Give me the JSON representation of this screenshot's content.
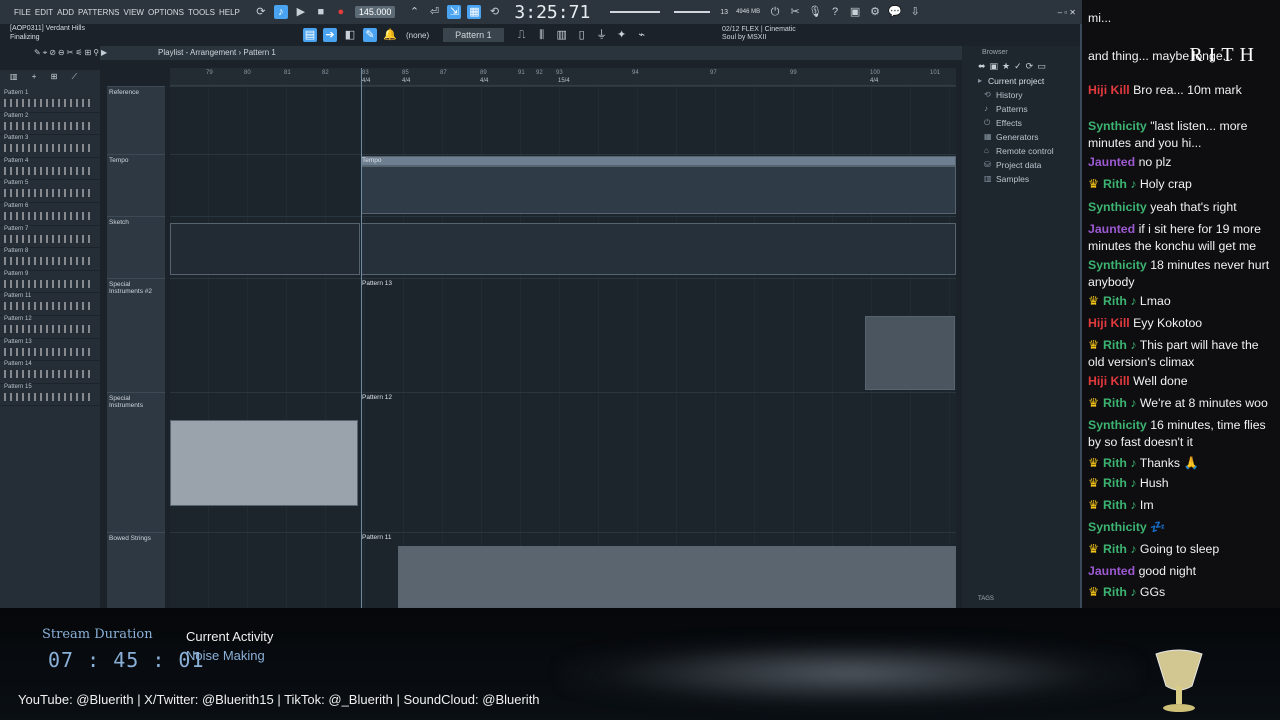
{
  "app": {
    "menu": [
      "FILE",
      "EDIT",
      "ADD",
      "PATTERNS",
      "VIEW",
      "OPTIONS",
      "TOOLS",
      "HELP"
    ],
    "tempo": "145.000",
    "clock": "3:25:71",
    "clock_suffix": "",
    "memory": "4946 MB",
    "cpu_small": "13",
    "song_line1": "[AOP0311] Verdant Hills",
    "song_line2": "Finalizing",
    "pattern_selector": "Pattern 1",
    "snap": "(none)",
    "flex_line1": "02/12  FLEX | Cinematic",
    "flex_line2": "Soul by MSXII"
  },
  "playlist": {
    "title": "Playlist - Arrangement",
    "pattern": "Pattern 1",
    "ruler_ticks": [
      "79",
      "80",
      "81",
      "82",
      "83",
      "85",
      "87",
      "89",
      "91",
      "92",
      "93",
      "94",
      "97",
      "99",
      "100",
      "101"
    ],
    "time_sigs": [
      "4/4",
      "4/4",
      "4/4",
      "15/4",
      "4/4"
    ],
    "tracks": [
      {
        "name": "Reference"
      },
      {
        "name": "Tempo"
      },
      {
        "name": "Sketch"
      },
      {
        "name": "Special Instruments #2"
      },
      {
        "name": "Special Instruments"
      },
      {
        "name": "Bowed Strings"
      }
    ],
    "clips": [
      "Tempo",
      "Pattern 13",
      "Pattern 12",
      "Pattern 11"
    ]
  },
  "patterns": [
    "Pattern 1",
    "Pattern 2",
    "Pattern 3",
    "Pattern 4",
    "Pattern 5",
    "Pattern 6",
    "Pattern 7",
    "Pattern 8",
    "Pattern 9",
    "Pattern 11",
    "Pattern 12",
    "Pattern 13",
    "Pattern 14",
    "Pattern 15"
  ],
  "browser": {
    "title": "Browser",
    "items": [
      {
        "label": "Current project",
        "icon": "folder-icon"
      },
      {
        "label": "History",
        "icon": "history-icon"
      },
      {
        "label": "Patterns",
        "icon": "note-icon"
      },
      {
        "label": "Effects",
        "icon": "plug-icon"
      },
      {
        "label": "Generators",
        "icon": "generator-icon"
      },
      {
        "label": "Remote control",
        "icon": "remote-icon"
      },
      {
        "label": "Project data",
        "icon": "data-icon"
      },
      {
        "label": "Samples",
        "icon": "sample-icon"
      }
    ],
    "tags": "TAGS"
  },
  "chat": {
    "brand": "RITH",
    "messages": [
      {
        "user": "",
        "text": "mi...",
        "color": "#f2f2f2",
        "crown": false
      },
      {
        "user": "",
        "text": "and thing... maybe longe...",
        "color": "#f2f2f2",
        "crown": false
      },
      {
        "user": "Hiji Kill",
        "text": "Bro rea... 10m mark",
        "color": "#e0393e",
        "crown": false
      },
      {
        "user": "Synthicity",
        "text": "\"last listen... more minutes and you hi...",
        "color": "#3cb371",
        "crown": false
      },
      {
        "user": "Jaunted",
        "text": "no plz",
        "color": "#9b59d0",
        "crown": false
      },
      {
        "user": "Rith ♪",
        "text": "Holy crap",
        "color": "#3cb371",
        "crown": true
      },
      {
        "user": "Synthicity",
        "text": "yeah that's right",
        "color": "#3cb371",
        "crown": false
      },
      {
        "user": "Jaunted",
        "text": "if i sit here for 19 more minutes the konchu will get me",
        "color": "#9b59d0",
        "crown": false
      },
      {
        "user": "Synthicity",
        "text": "18 minutes never hurt anybody",
        "color": "#3cb371",
        "crown": false
      },
      {
        "user": "Rith ♪",
        "text": "Lmao",
        "color": "#3cb371",
        "crown": true
      },
      {
        "user": "Hiji Kill",
        "text": "Eyy Kokotoo",
        "color": "#e0393e",
        "crown": false
      },
      {
        "user": "Rith ♪",
        "text": "This part will have the old version's climax",
        "color": "#3cb371",
        "crown": true
      },
      {
        "user": "Hiji Kill",
        "text": "Well done",
        "color": "#e0393e",
        "crown": false
      },
      {
        "user": "Rith ♪",
        "text": "We're at 8 minutes woo",
        "color": "#3cb371",
        "crown": true
      },
      {
        "user": "Synthicity",
        "text": "16 minutes, time flies by so fast doesn't it",
        "color": "#3cb371",
        "crown": false
      },
      {
        "user": "Rith ♪",
        "text": "Thanks 🙏",
        "color": "#3cb371",
        "crown": true
      },
      {
        "user": "Rith ♪",
        "text": "Hush",
        "color": "#3cb371",
        "crown": true
      },
      {
        "user": "Rith ♪",
        "text": "Im",
        "color": "#3cb371",
        "crown": true
      },
      {
        "user": "Synthicity",
        "text": "💤",
        "color": "#3cb371",
        "crown": false
      },
      {
        "user": "Rith ♪",
        "text": "Going to sleep",
        "color": "#3cb371",
        "crown": true
      },
      {
        "user": "Jaunted",
        "text": "good night",
        "color": "#9b59d0",
        "crown": false
      },
      {
        "user": "Rith ♪",
        "text": "GGs",
        "color": "#3cb371",
        "crown": true
      }
    ]
  },
  "stream": {
    "duration_label": "Stream Duration",
    "duration": "07 : 45 : 01",
    "activity_label": "Current Activity",
    "activity": "Noise Making",
    "socials": "YouTube: @Bluerith  |  X/Twitter: @Bluerith15  |  TikTok: @_Bluerith  |  SoundCloud: @Bluerith"
  }
}
